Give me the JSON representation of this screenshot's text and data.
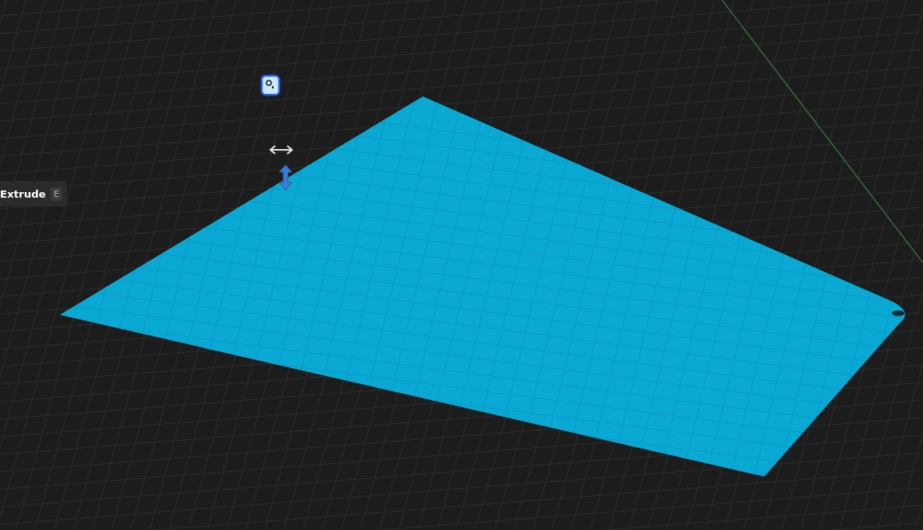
{
  "tooltip": {
    "label": "Extrude",
    "shortcut": "E"
  }
}
